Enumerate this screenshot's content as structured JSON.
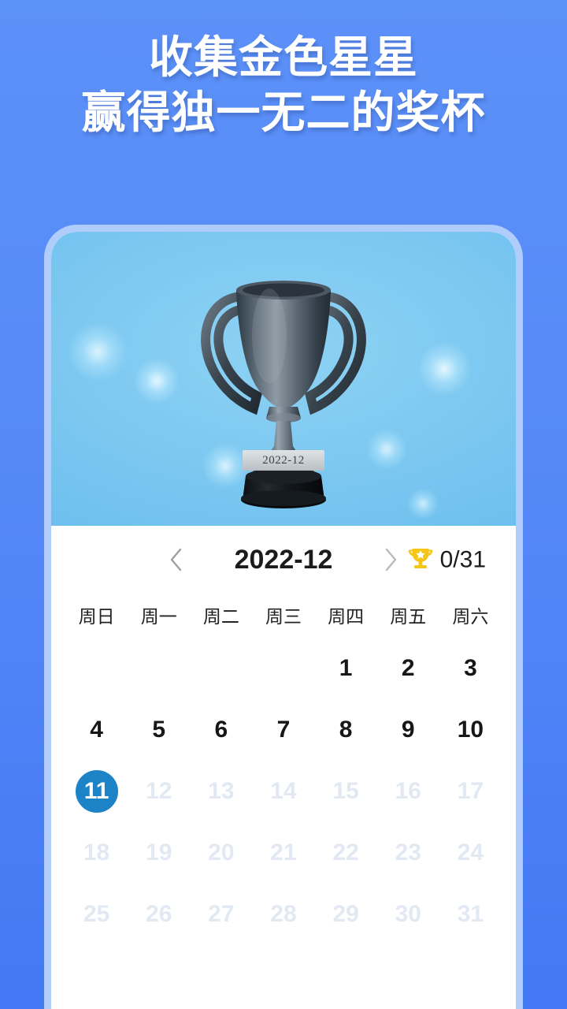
{
  "promo": {
    "line1": "收集金色星星",
    "line2": "赢得独一无二的奖杯"
  },
  "trophy_banner": {
    "plaque_label": "2022-12",
    "icon": "trophy-3d"
  },
  "calendar": {
    "prev_icon": "chevron-left-icon",
    "next_icon": "chevron-right-icon",
    "month_label": "2022-12",
    "score_icon": "trophy-star-icon",
    "score_text": "0/31",
    "weekdays": [
      "周日",
      "周一",
      "周二",
      "周三",
      "周四",
      "周五",
      "周六"
    ],
    "weeks": [
      [
        "",
        "",
        "",
        "",
        "1",
        "2",
        "3"
      ],
      [
        "4",
        "5",
        "6",
        "7",
        "8",
        "9",
        "10"
      ],
      [
        "11",
        "12",
        "13",
        "14",
        "15",
        "16",
        "17"
      ],
      [
        "18",
        "19",
        "20",
        "21",
        "22",
        "23",
        "24"
      ],
      [
        "25",
        "26",
        "27",
        "28",
        "29",
        "30",
        "31"
      ]
    ],
    "today": "11",
    "future_from": 12
  },
  "colors": {
    "background_top": "#5c91f8",
    "background_bottom": "#4478f4",
    "frame_border": "#b0ccfb",
    "banner_light": "#8ed2f4",
    "banner_dark": "#47a9e6",
    "today_circle": "#1b83c6",
    "future_day_text": "#e2e9f3",
    "score_gold": "#f5c518"
  }
}
